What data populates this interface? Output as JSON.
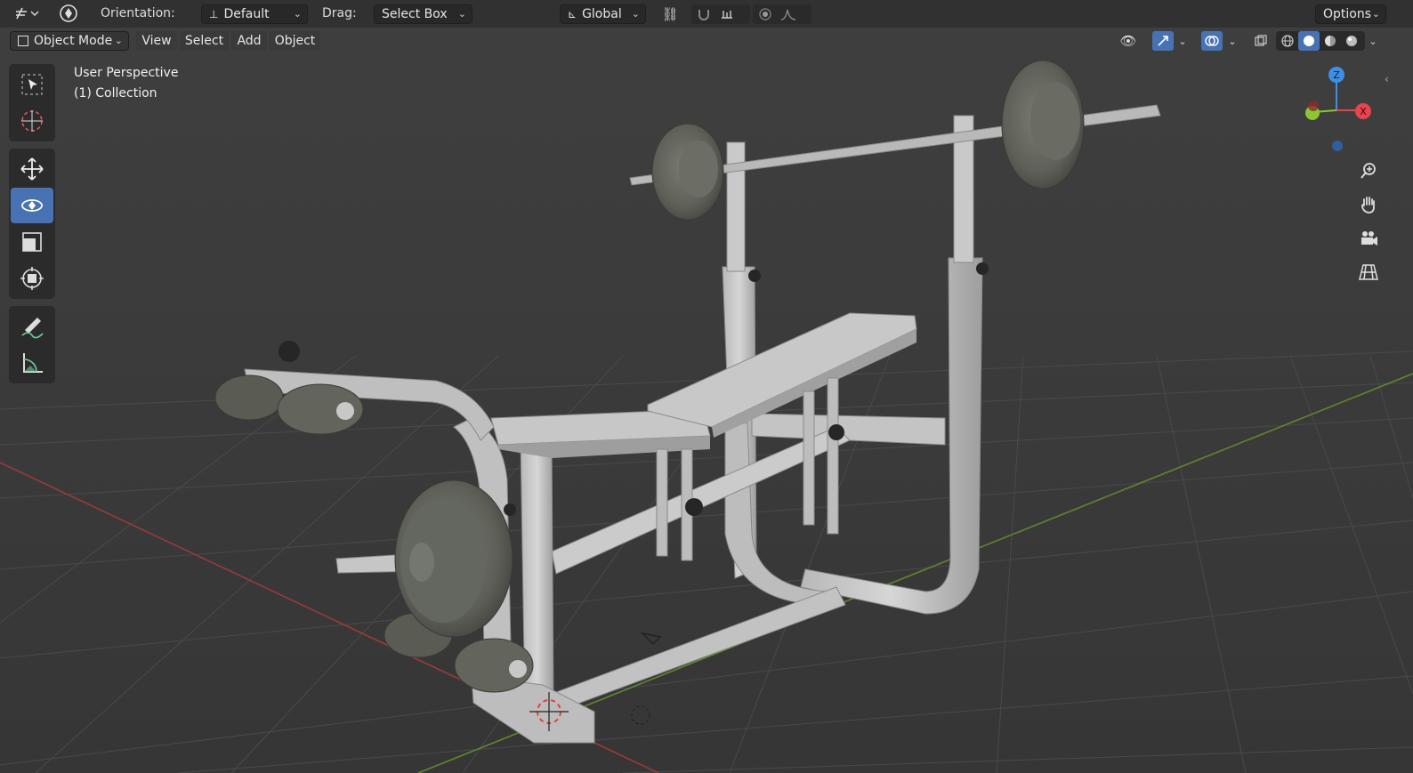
{
  "topbar": {
    "orientation_label": "Orientation:",
    "orientation_value": "Default",
    "drag_label": "Drag:",
    "drag_value": "Select Box",
    "transform_space": "Global",
    "options_label": "Options"
  },
  "header": {
    "mode": "Object Mode",
    "menus": [
      "View",
      "Select",
      "Add",
      "Object"
    ]
  },
  "viewport": {
    "perspective": "User Perspective",
    "collection": "(1) Collection"
  },
  "toolbar": {
    "tools": [
      "select-box",
      "cursor",
      "move",
      "rotate",
      "scale",
      "transform",
      "annotate",
      "measure"
    ],
    "active_tool": "rotate"
  },
  "gizmo": {
    "axes": [
      "Z",
      "X"
    ],
    "colors": {
      "x": "#e8434f",
      "y": "#8ac733",
      "z": "#3f8ee8"
    }
  },
  "colors": {
    "accent": "#4772b3",
    "background": "#3d3d3d",
    "grid_x_axis": "#b23b3b",
    "grid_y_axis": "#6c9c2a"
  }
}
